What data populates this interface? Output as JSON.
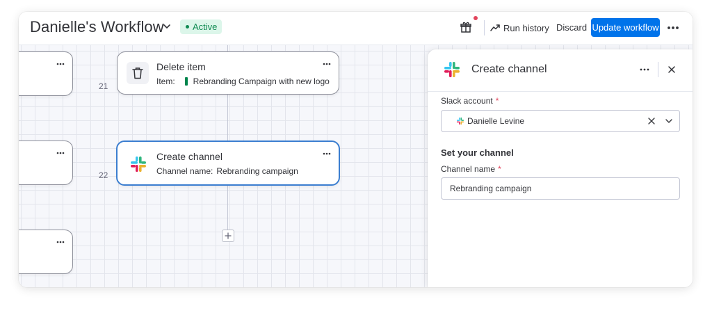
{
  "header": {
    "title": "Danielle's Workflow",
    "status": "Active",
    "run_history_label": "Run history",
    "discard_label": "Discard",
    "update_label": "Update workflow",
    "icons": [
      "chevron-down-icon",
      "gift-icon",
      "trend-icon",
      "more-icon"
    ]
  },
  "canvas": {
    "cards": [
      {
        "row": "21",
        "title": "Delete item",
        "field_label": "Item:",
        "field_value": "Rebranding Campaign with new logo",
        "icon": "trash-icon"
      },
      {
        "row": "22",
        "title": "Create channel",
        "field_label": "Channel name:",
        "field_value": "Rebranding campaign",
        "icon": "slack-icon",
        "selected": true
      }
    ]
  },
  "panel": {
    "title": "Create channel",
    "slack_account_label": "Slack account",
    "slack_account_value": "Danielle Levine",
    "section_title": "Set your channel",
    "channel_name_label": "Channel name",
    "channel_name_value": "Rebranding campaign",
    "required_mark": "*"
  },
  "colors": {
    "primary": "#0073ea",
    "active_badge_bg": "#dcf6ea",
    "active_badge_text": "#0f8a52",
    "selected_border": "#3b7ed0",
    "required": "#e2445c",
    "item_group": "#00854d"
  }
}
